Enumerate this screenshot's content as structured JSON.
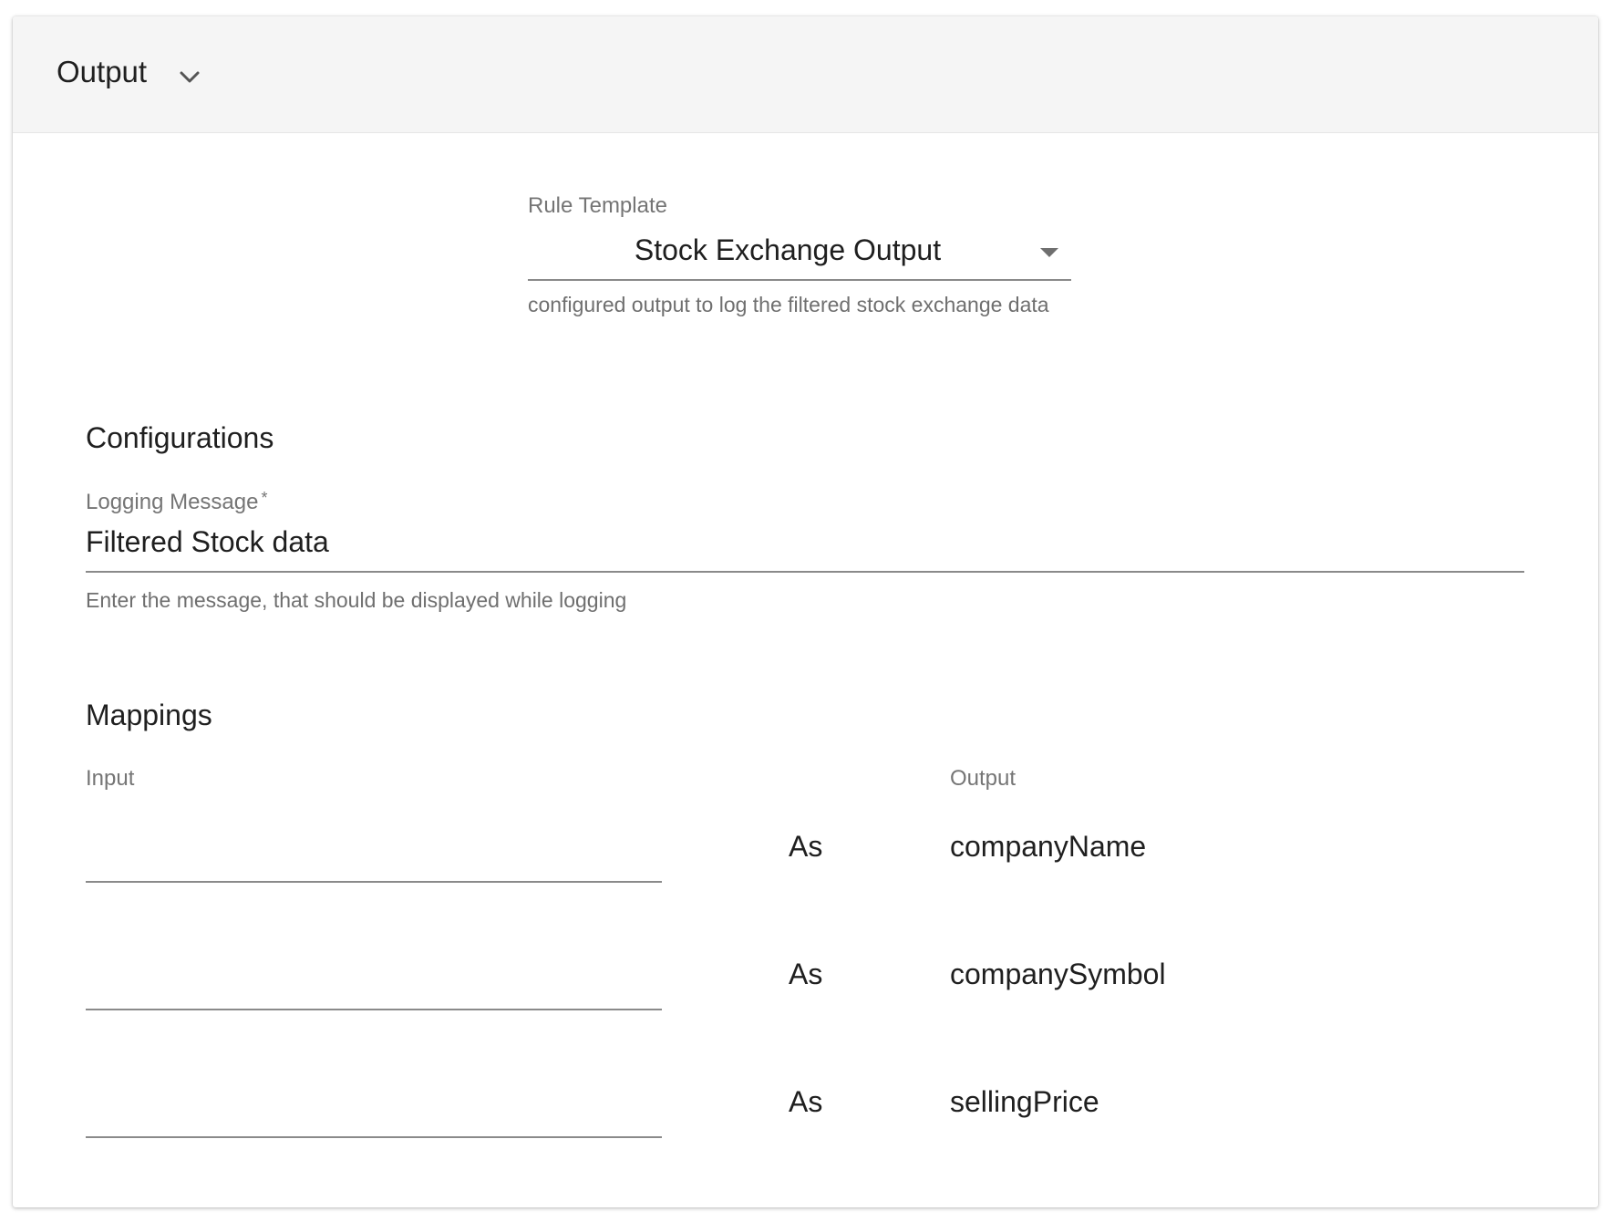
{
  "header": {
    "title": "Output",
    "toggle_icon": "chevron-down-icon"
  },
  "rule_template": {
    "label": "Rule Template",
    "value": "Stock Exchange Output",
    "helper": "configured output to log the filtered stock exchange data",
    "caret_icon": "caret-down-icon"
  },
  "configurations": {
    "title": "Configurations",
    "logging_message": {
      "label": "Logging Message",
      "required_mark": "*",
      "value": "Filtered Stock data",
      "helper": "Enter the message, that should be displayed while logging"
    }
  },
  "mappings": {
    "title": "Mappings",
    "input_header": "Input",
    "output_header": "Output",
    "rows": [
      {
        "input": "",
        "as": "As",
        "output": "companyName"
      },
      {
        "input": "",
        "as": "As",
        "output": "companySymbol"
      },
      {
        "input": "",
        "as": "As",
        "output": "sellingPrice"
      }
    ]
  }
}
